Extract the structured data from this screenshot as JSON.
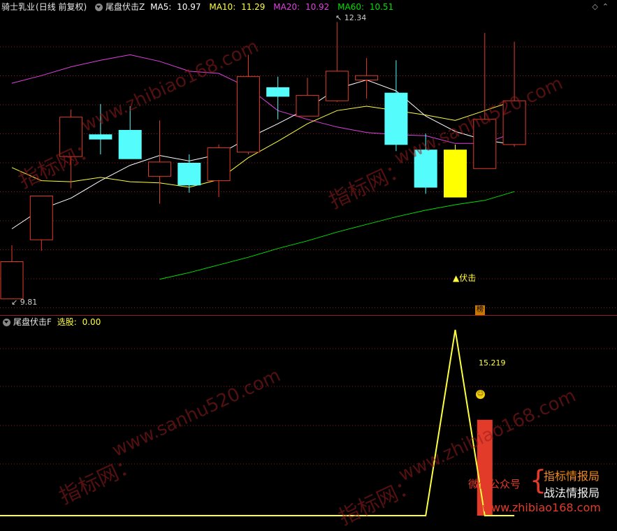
{
  "header": {
    "stock_name": "骑士乳业",
    "period": "(日线 前复权)",
    "indicator": "尾盘伏击Z",
    "ma5_label": "MA5:",
    "ma5_value": "10.97",
    "ma10_label": "MA10:",
    "ma10_value": "11.29",
    "ma20_label": "MA20:",
    "ma20_value": "10.92",
    "ma60_label": "MA60:",
    "ma60_value": "10.51"
  },
  "sub_header": {
    "indicator": "尾盘伏击F",
    "select_label": "选股:",
    "select_value": "0.00"
  },
  "annotations": {
    "high_price": "12.34",
    "low_price": "9.81",
    "signal_label": "▲伏击",
    "badge": "榜",
    "sub_value": "15.219"
  },
  "promo": {
    "wechat": "微信公众号",
    "line1": "指标情报局",
    "line2": "战法情报局",
    "url": "www.zhibiao168.com"
  },
  "watermarks": [
    "指标网：",
    "www.zhibiao168.com",
    "www.sanhu520.com"
  ],
  "colors": {
    "up": "#e23b2a",
    "down": "#54fcfc",
    "signal": "#ffff00",
    "ma5": "#ffffff",
    "ma10": "#ffff3c",
    "ma20": "#e040e0",
    "ma60": "#00e000"
  },
  "chart_data": {
    "type": "candlestick",
    "candles": [
      {
        "o": 9.81,
        "c": 10.15,
        "h": 10.3,
        "l": 9.81,
        "color": "up"
      },
      {
        "o": 10.35,
        "c": 10.75,
        "h": 10.75,
        "l": 10.25,
        "color": "up"
      },
      {
        "o": 11.11,
        "c": 11.47,
        "h": 11.54,
        "l": 10.82,
        "color": "up"
      },
      {
        "o": 11.31,
        "c": 11.27,
        "h": 11.59,
        "l": 11.13,
        "color": "down"
      },
      {
        "o": 11.35,
        "c": 11.09,
        "h": 11.57,
        "l": 11.11,
        "color": "down"
      },
      {
        "o": 10.93,
        "c": 11.06,
        "h": 11.44,
        "l": 10.68,
        "color": "up"
      },
      {
        "o": 11.05,
        "c": 10.85,
        "h": 11.13,
        "l": 10.78,
        "color": "down"
      },
      {
        "o": 10.89,
        "c": 11.19,
        "h": 11.22,
        "l": 10.74,
        "color": "up"
      },
      {
        "o": 11.15,
        "c": 11.84,
        "h": 12.04,
        "l": 11.13,
        "color": "up"
      },
      {
        "o": 11.74,
        "c": 11.66,
        "h": 11.84,
        "l": 11.45,
        "color": "down"
      },
      {
        "o": 11.48,
        "c": 11.67,
        "h": 11.83,
        "l": 11.48,
        "color": "up"
      },
      {
        "o": 11.62,
        "c": 11.89,
        "h": 12.34,
        "l": 11.61,
        "color": "up"
      },
      {
        "o": 11.81,
        "c": 11.85,
        "h": 12.01,
        "l": 11.64,
        "color": "up"
      },
      {
        "o": 11.69,
        "c": 11.22,
        "h": 11.99,
        "l": 11.16,
        "color": "down"
      },
      {
        "o": 11.17,
        "c": 10.83,
        "h": 11.32,
        "l": 10.77,
        "color": "down"
      },
      {
        "o": 11.17,
        "c": 10.74,
        "h": 11.22,
        "l": 10.74,
        "color": "signal"
      },
      {
        "o": 11.0,
        "c": 11.45,
        "h": 12.24,
        "l": 11.0,
        "color": "up"
      },
      {
        "o": 11.22,
        "c": 11.62,
        "h": 12.16,
        "l": 11.2,
        "color": "up"
      }
    ],
    "ma5": [
      10.45,
      10.63,
      10.73,
      10.89,
      11.03,
      11.12,
      11.07,
      11.13,
      11.28,
      11.41,
      11.55,
      11.73,
      11.81,
      11.71,
      11.48,
      11.34,
      11.26,
      11.22
    ],
    "ma10": [
      11.01,
      10.89,
      10.88,
      10.92,
      10.88,
      10.87,
      10.83,
      10.9,
      11.1,
      11.25,
      11.41,
      11.53,
      11.57,
      11.53,
      11.49,
      11.44,
      11.53,
      11.62
    ],
    "ma20": [
      11.78,
      11.85,
      11.93,
      11.99,
      12.04,
      11.98,
      11.89,
      11.87,
      11.74,
      11.53,
      11.45,
      11.38,
      11.33,
      11.31,
      11.3,
      11.23,
      11.23,
      11.33
    ],
    "ma60": [
      null,
      null,
      null,
      null,
      null,
      9.99,
      10.05,
      10.12,
      10.19,
      10.27,
      10.34,
      10.42,
      10.49,
      10.56,
      10.62,
      10.67,
      10.71,
      10.79
    ],
    "ylim": [
      9.7,
      12.4
    ],
    "sub": {
      "line": [
        0,
        0,
        0,
        0,
        0,
        0,
        0,
        0,
        0,
        0,
        0,
        0,
        0,
        0,
        0,
        32,
        0,
        0
      ],
      "ylim": [
        0,
        32
      ],
      "bar_index": 16,
      "bar_value": 16.5
    }
  }
}
